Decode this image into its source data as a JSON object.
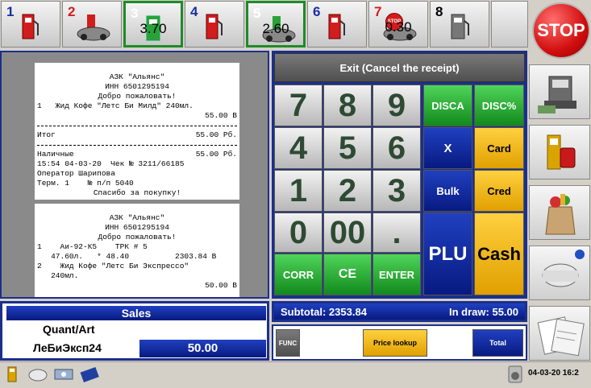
{
  "pumps": [
    {
      "number": "1",
      "amount": "",
      "color": "#1a2fa0",
      "icon": "fuel-pump-icon",
      "state": "idle"
    },
    {
      "number": "2",
      "amount": "",
      "color": "#d21d1d",
      "icon": "car-fuel-icon",
      "state": "idle"
    },
    {
      "number": "3",
      "amount": "3.70",
      "color": "#ffffff",
      "icon": "fuel-pump-icon",
      "state": "selected"
    },
    {
      "number": "4",
      "amount": "",
      "color": "#1a2fa0",
      "icon": "fuel-pump-icon",
      "state": "idle"
    },
    {
      "number": "5",
      "amount": "2.60",
      "color": "#ffffff",
      "icon": "car-fuel-icon",
      "state": "selected"
    },
    {
      "number": "6",
      "amount": "",
      "color": "#1a2fa0",
      "icon": "fuel-pump-icon",
      "state": "idle"
    },
    {
      "number": "7",
      "amount": "0.30",
      "color": "#d21d1d",
      "icon": "stop-sign-icon",
      "state": "stopped"
    },
    {
      "number": "8",
      "amount": "",
      "color": "#000000",
      "icon": "fuel-pump-icon",
      "state": "idle"
    }
  ],
  "stop_label": "STOP",
  "receipt1": {
    "header": [
      "АЗК \"Альянс\"",
      "ИНН 6501295194",
      "Добро пожаловать!"
    ],
    "item_line": "1   Жид Кофе \"Летс Би Милд\" 240мл.",
    "item_price": "55.00 В",
    "total_label": "Итог",
    "total_value": "55.00 Рб.",
    "cash_label": "Наличные",
    "cash_value": "55.00 Рб.",
    "info": [
      "15:54 04-03-20  Чек № 3211/66185",
      "Оператор Шарипова",
      "Терм. 1    № п/п 5040"
    ],
    "thanks": "Спасибо за покупку!"
  },
  "receipt2": {
    "header": [
      "АЗК \"Альянс\"",
      "ИНН 6501295194",
      "Добро пожаловать!"
    ],
    "lines": [
      "1    Аи-92-К5    ТРК # 5",
      "   47.60л.   * 48.40          2303.84 В",
      "2    Жид Кофе \"Летс Би Экспрессо\"",
      "   240мл."
    ],
    "last_price": "50.00 В"
  },
  "keypad": {
    "exit": "Exit (Cancel the receipt)",
    "digits": [
      "7",
      "8",
      "9",
      "4",
      "5",
      "6",
      "1",
      "2",
      "3",
      "0",
      "00",
      "."
    ],
    "disca": "DISCA",
    "discp": "DISC%",
    "x": "X",
    "card": "Card",
    "bulk": "Bulk",
    "cred": "Cred",
    "plu": "PLU",
    "cash": "Cash",
    "corr": "CORR",
    "ce": "CE",
    "enter": "ENTER"
  },
  "sales": {
    "title": "Sales",
    "quant_label": "Quant/Art",
    "item_name": "ЛеБиЭксп24",
    "amount": "50.00"
  },
  "subtotal": {
    "label": "Subtotal: 2353.84",
    "drawer": "In draw: 55.00"
  },
  "bottom": {
    "func": "FUNC",
    "price_lookup": "Price lookup",
    "total": "Total"
  },
  "side_icons": [
    "cash-register-icon",
    "fuel-canister-icon",
    "grocery-bag-icon",
    "gas-tank-icon",
    "receipts-icon"
  ],
  "status": {
    "clock": "04-03-20 16:2"
  },
  "colors": {
    "frame_blue": "#1c2f8c",
    "green_key": "#128a1d",
    "orange_key": "#e0a000"
  }
}
